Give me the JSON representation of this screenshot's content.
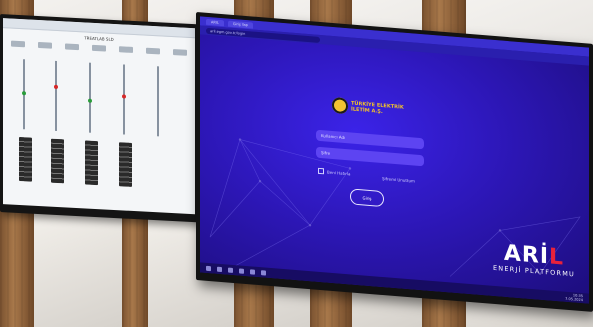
{
  "left_monitor": {
    "page_heading": "TREATLAB SLD",
    "tab_label": "",
    "indicator_colors": [
      "#2a9d3a",
      "#d62828",
      "#2a9d3a",
      "#d62828"
    ]
  },
  "right_monitor": {
    "tabs": [
      "ARIL",
      "Giriş Yap"
    ],
    "url": "aril.egm.gov.tr/login",
    "logo_text": [
      "TÜRKİYE ELEKTRİK",
      "İLETİM A.Ş."
    ],
    "username_placeholder": "Kullanıcı Adı",
    "password_placeholder": "Şifre",
    "remember_label": "Beni Hatırla",
    "forgot_label": "Şifremi Unuttum",
    "login_button": "Giriş",
    "brand_name_main": "ARİ",
    "brand_name_accent": "L",
    "brand_subtitle": "ENERJİ PLATFORMU",
    "clock_time": "10:35",
    "clock_date": "7.05.2024"
  },
  "colors": {
    "screen_background": "#2d17b8",
    "brand_accent": "#e8223a",
    "logo_gold": "#f2c232"
  }
}
